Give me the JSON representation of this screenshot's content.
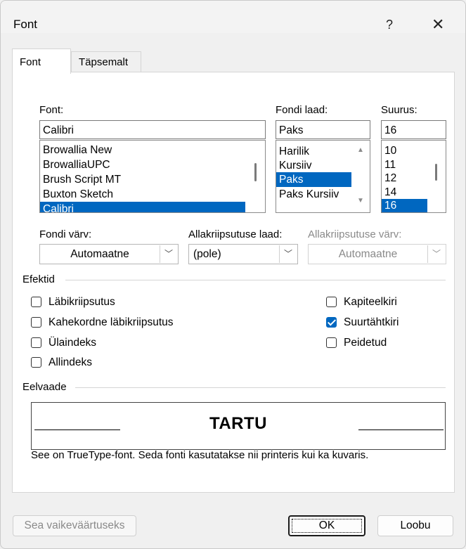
{
  "window": {
    "title": "Font",
    "help_label": "?",
    "close_label": "✕"
  },
  "tabs": [
    {
      "label": "Font"
    },
    {
      "label": "Täpsemalt"
    }
  ],
  "font": {
    "label": "Font:",
    "value": "Calibri",
    "list": [
      "Browallia New",
      "BrowalliaUPC",
      "Brush Script MT",
      "Buxton Sketch",
      "Calibri"
    ],
    "selected": "Calibri"
  },
  "style": {
    "label": "Fondi laad:",
    "value": "Paks",
    "list": [
      "Harilik",
      "Kursiiv",
      "Paks",
      "Paks Kursiiv"
    ],
    "selected": "Paks"
  },
  "size": {
    "label": "Suurus:",
    "value": "16",
    "list": [
      "10",
      "11",
      "12",
      "14",
      "16"
    ],
    "selected": "16"
  },
  "font_color": {
    "label": "Fondi värv:",
    "value": "Automaatne"
  },
  "underline_style": {
    "label": "Allakriipsutuse laad:",
    "value": "(pole)"
  },
  "underline_color": {
    "label": "Allakriipsutuse värv:",
    "value": "Automaatne"
  },
  "effects": {
    "label": "Efektid",
    "left": [
      {
        "label": "Läbikriipsutus",
        "checked": false
      },
      {
        "label": "Kahekordne läbikriipsutus",
        "checked": false
      },
      {
        "label": "Ülaindeks",
        "checked": false
      },
      {
        "label": "Allindeks",
        "checked": false
      }
    ],
    "right": [
      {
        "label": "Kapiteelkiri",
        "checked": false
      },
      {
        "label": "Suurtähtkiri",
        "checked": true
      },
      {
        "label": "Peidetud",
        "checked": false
      }
    ]
  },
  "preview": {
    "label": "Eelvaade",
    "sample": "TARTU",
    "note": "See on TrueType-font. Seda fonti kasutatakse nii printeris kui ka kuvaris."
  },
  "buttons": {
    "default": "Sea vaikeväärtuseks",
    "ok": "OK",
    "cancel": "Loobu"
  },
  "colors": {
    "accent": "#0067c0"
  }
}
